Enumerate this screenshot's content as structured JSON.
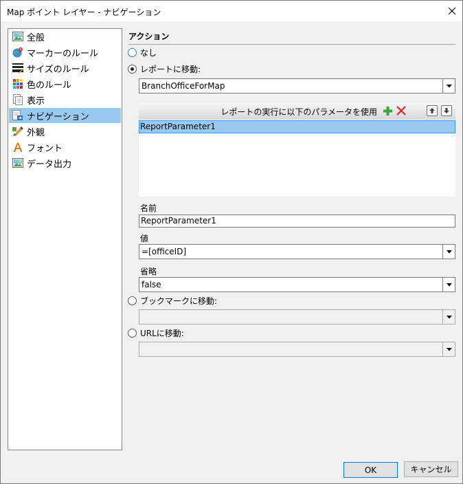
{
  "window": {
    "title": "Map ポイント レイヤー - ナビゲーション"
  },
  "nav": {
    "items": [
      {
        "label": "全般",
        "icon": "general-image-icon"
      },
      {
        "label": "マーカーのルール",
        "icon": "marker-rule-icon"
      },
      {
        "label": "サイズのルール",
        "icon": "size-rule-icon"
      },
      {
        "label": "色のルール",
        "icon": "color-rule-icon"
      },
      {
        "label": "表示",
        "icon": "visibility-icon"
      },
      {
        "label": "ナビゲーション",
        "icon": "navigation-icon"
      },
      {
        "label": "外観",
        "icon": "appearance-icon"
      },
      {
        "label": "フォント",
        "icon": "font-icon"
      },
      {
        "label": "データ出力",
        "icon": "data-output-icon"
      }
    ],
    "selected": "ナビゲーション"
  },
  "action": {
    "section_title": "アクション",
    "none_label": "なし",
    "goto_report_label": "レポートに移動:",
    "report_value": "BranchOfficeForMap",
    "param_header_label": "レポートの実行に以下のパラメータを使用",
    "parameters": [
      "ReportParameter1"
    ],
    "name_label": "名前",
    "name_value": "ReportParameter1",
    "value_label": "値",
    "value_value": "=[officeID]",
    "omit_label": "省略",
    "omit_value": "false",
    "goto_bookmark_label": "ブックマークに移動:",
    "bookmark_value": "",
    "goto_url_label": "URLに移動:",
    "url_value": "",
    "selected": "goto_report"
  },
  "buttons": {
    "ok": "OK",
    "cancel": "キャンセル"
  },
  "colors": {
    "selection": "#99c9ef",
    "add_icon": "#3aa63a",
    "delete_icon": "#e02020"
  }
}
